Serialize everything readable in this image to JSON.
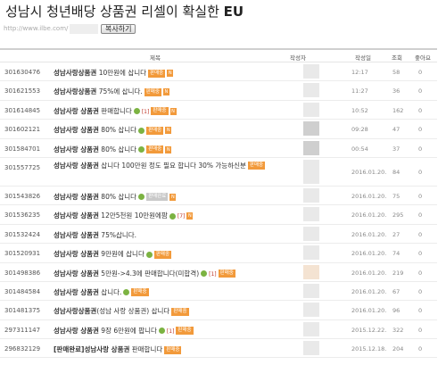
{
  "page": {
    "title_main": "성남시 청년배당 상품권 리셀이 확실한",
    "title_tag": "EU",
    "url": "http://www.ilbe.com/",
    "copy_button": "복사하기"
  },
  "table": {
    "headers": {
      "subject": "제목",
      "author": "작성자",
      "date": "작성일",
      "views": "조회",
      "likes": "좋아요"
    },
    "rows": [
      {
        "no": "301630476",
        "kw": "성남사랑상품권",
        "text": " 10만원에 삽니다",
        "comments": "",
        "badge": "판매중",
        "date": "12:17",
        "views": "58",
        "likes": "0"
      },
      {
        "no": "301621553",
        "kw": "성남사랑상품권",
        "text": " 75%에 삽니다.",
        "comments": "",
        "badge": "판매중",
        "date": "11:27",
        "views": "36",
        "likes": "0"
      },
      {
        "no": "301614845",
        "kw": "성남사랑 상품권",
        "text": " 판매합니다",
        "comments": "[1]",
        "badge": "판매중",
        "date": "10:52",
        "views": "162",
        "likes": "0"
      },
      {
        "no": "301602121",
        "kw": "성남사랑 상품권",
        "text": " 80% 삽니다",
        "comments": "",
        "badge": "판매중",
        "date": "09:28",
        "views": "47",
        "likes": "0"
      },
      {
        "no": "301584701",
        "kw": "성남사랑 상품권",
        "text": " 80% 삽니다",
        "comments": "",
        "badge": "판매중",
        "date": "00:54",
        "views": "37",
        "likes": "0"
      },
      {
        "no": "301557725",
        "kw": "성남사랑 상품권",
        "text": " 삽니다 100만원 정도 필요 합니다 30% 가능하신분",
        "comments": "",
        "badge": "판매중",
        "date": "2016.01.20.",
        "views": "84",
        "likes": "0"
      },
      {
        "no": "301543826",
        "kw": "성남사랑 상품권",
        "text": " 80% 삽니다",
        "comments": "",
        "badge": "판매완료",
        "date": "2016.01.20.",
        "views": "75",
        "likes": "0"
      },
      {
        "no": "301536235",
        "kw": "성남사랑 상품권",
        "text": " 12만5천원 10만원에팜",
        "comments": "[7]",
        "badge": "",
        "date": "2016.01.20.",
        "views": "295",
        "likes": "0"
      },
      {
        "no": "301532424",
        "kw": "성남사랑 상품권",
        "text": " 75%삽니다.",
        "comments": "",
        "badge": "",
        "date": "2016.01.20.",
        "views": "27",
        "likes": "0"
      },
      {
        "no": "301520931",
        "kw": "성남사랑 상품권",
        "text": " 9만원에 삽니다",
        "comments": "",
        "badge": "판매중",
        "date": "2016.01.20.",
        "views": "74",
        "likes": "0"
      },
      {
        "no": "301498386",
        "kw": "성남사랑 상품권",
        "text": " 5만원->4.3에 판매합니다(미합격)",
        "comments": "[1]",
        "badge": "판매중",
        "date": "2016.01.20.",
        "views": "219",
        "likes": "0"
      },
      {
        "no": "301484584",
        "kw": "성남사랑 상품권",
        "text": " 삽니다.",
        "comments": "",
        "badge": "판매중",
        "date": "2016.01.20.",
        "views": "67",
        "likes": "0"
      },
      {
        "no": "301481375",
        "kw": "성남사랑상품권",
        "text": "(성남 사랑 상품권) 삽니다",
        "comments": "",
        "badge": "판매중",
        "date": "2016.01.20.",
        "views": "96",
        "likes": "0"
      },
      {
        "no": "297311147",
        "kw": "성남사랑 상품권",
        "text": " 9장 6만원에 팝니다",
        "comments": "[1]",
        "badge": "판매중",
        "date": "2015.12.22.",
        "views": "322",
        "likes": "0"
      },
      {
        "no": "296832129",
        "kw": "[판매완료]성남사랑 상품권",
        "text": " 판매합니다",
        "comments": "",
        "badge": "판매중",
        "date": "2015.12.18.",
        "views": "204",
        "likes": "0"
      }
    ]
  }
}
